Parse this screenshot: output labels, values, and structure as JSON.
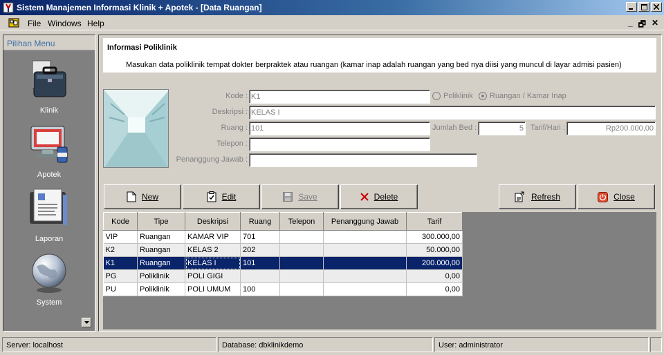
{
  "window": {
    "title": "Sistem Manajemen Informasi Klinik + Apotek - [Data Ruangan]"
  },
  "menu": {
    "items": [
      "File",
      "Windows",
      "Help"
    ]
  },
  "sidebar": {
    "header": "Pilihan Menu",
    "items": [
      {
        "label": "Klinik",
        "icon": "briefcase-icon"
      },
      {
        "label": "Apotek",
        "icon": "pharmacy-monitor-icon"
      },
      {
        "label": "Laporan",
        "icon": "report-folder-icon"
      },
      {
        "label": "System",
        "icon": "globe-icon"
      }
    ]
  },
  "info": {
    "heading": "Informasi Poliklinik",
    "description": "Masukan data poliklinik tempat dokter berpraktek atau ruangan (kamar inap adalah ruangan yang bed nya diisi yang muncul di layar admisi pasien)"
  },
  "form": {
    "kode_label": "Kode :",
    "kode_value": "K1",
    "deskripsi_label": "Deskripsi :",
    "deskripsi_value": "KELAS I",
    "ruang_label": "Ruang :",
    "ruang_value": "101",
    "telepon_label": "Telepon :",
    "telepon_value": "",
    "pj_label": "Penanggung Jawab :",
    "pj_value": "",
    "radio_poliklinik": "Poliklinik",
    "radio_ruangan": "Ruangan / Kamar Inap",
    "selected_type": "Ruangan / Kamar Inap",
    "jumlah_bed_label": "Jumlah Bed :",
    "jumlah_bed_value": "5",
    "tarif_label": "Tarif/Hari :",
    "tarif_value": "Rp200.000,00"
  },
  "toolbar": {
    "new_label": "New",
    "edit_label": "Edit",
    "save_label": "Save",
    "delete_label": "Delete",
    "refresh_label": "Refresh",
    "close_label": "Close"
  },
  "grid": {
    "columns": [
      "Kode",
      "Tipe",
      "Deskripsi",
      "Ruang",
      "Telepon",
      "Penanggung Jawab",
      "Tarif"
    ],
    "selected_row": 2,
    "rows": [
      [
        "VIP",
        "Ruangan",
        "KAMAR VIP",
        "701",
        "",
        "",
        "300.000,00"
      ],
      [
        "K2",
        "Ruangan",
        "KELAS 2",
        "202",
        "",
        "",
        "50.000,00"
      ],
      [
        "K1",
        "Ruangan",
        "KELAS I",
        "101",
        "",
        "",
        "200.000,00"
      ],
      [
        "PG",
        "Poliklinik",
        "POLI GIGI",
        "",
        "",
        "",
        "0,00"
      ],
      [
        "PU",
        "Poliklinik",
        "POLI UMUM",
        "100",
        "",
        "",
        "0,00"
      ]
    ]
  },
  "status": {
    "server": "Server:  localhost",
    "database": "Database:  dbklinikdemo",
    "user": "User:  administrator"
  },
  "colors": {
    "titlebar": "#0a246a",
    "selection": "#0a246a",
    "sidebar_bg": "#808080",
    "close_icon": "#e04a2a",
    "delete_icon": "#cc0000"
  }
}
